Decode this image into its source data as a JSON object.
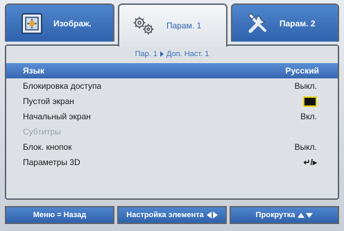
{
  "tabs": [
    {
      "label": "Изображ.",
      "icon": "image-adjust-icon",
      "active": false
    },
    {
      "label": "Парам. 1",
      "icon": "gears-icon",
      "active": true
    },
    {
      "label": "Парам. 2",
      "icon": "tools-icon",
      "active": false
    }
  ],
  "breadcrumb": {
    "part1": "Пар. 1",
    "part2": "Доп. Наст. 1"
  },
  "menu": [
    {
      "label": "Язык",
      "value": "Русский"
    },
    {
      "label": "Блокировка доступа",
      "value": "Выкл."
    },
    {
      "label": "Пустой экран",
      "value": ""
    },
    {
      "label": "Начальный экран",
      "value": "Вкл."
    },
    {
      "label": "Субтитры",
      "value": ""
    },
    {
      "label": "Блок. кнопок",
      "value": "Выкл."
    },
    {
      "label": "Параметры 3D",
      "value": "↵/▸"
    }
  ],
  "footer": {
    "menu_back": "Меню = Назад",
    "adjust": "Настройка элемента",
    "scroll": "Прокрутка"
  },
  "colors": {
    "accent": "#3766b0",
    "blank_swatch": "#111111",
    "swatch_border": "#e6d200"
  }
}
